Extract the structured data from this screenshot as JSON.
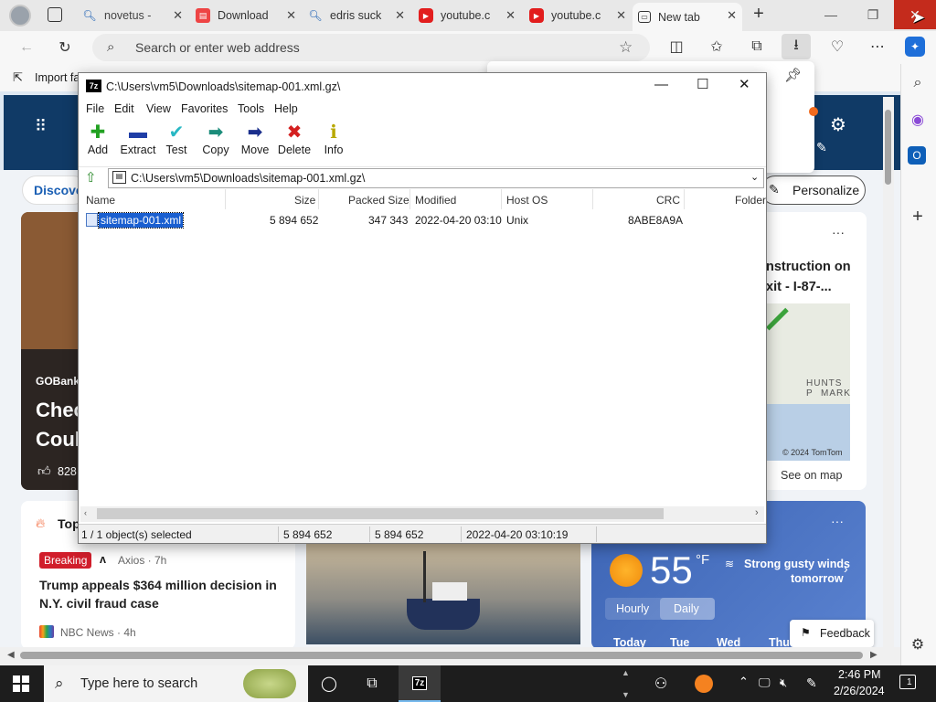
{
  "browser": {
    "tabs": [
      {
        "label": "novetus - ",
        "icon": "search-icon"
      },
      {
        "label": "Download",
        "icon": "download-page-icon"
      },
      {
        "label": "edris suck",
        "icon": "search-icon"
      },
      {
        "label": "youtube.c",
        "icon": "youtube-icon"
      },
      {
        "label": "youtube.c",
        "icon": "youtube-icon"
      },
      {
        "label": "New tab",
        "icon": "new-tab-icon"
      }
    ],
    "address_placeholder": "Search or enter web address",
    "favorites_import": "Import fa",
    "accent": "#0067c0"
  },
  "page": {
    "discover_label": "Discove",
    "personalize_label": "Personalize",
    "story_source": "GOBanki",
    "story_title_1": "Chec",
    "story_title_2": "Coul",
    "story_likes": "828",
    "traffic_title_1": "nstruction on",
    "traffic_title_2": "xit - I-87-...",
    "map_label_1": "HUNTS P",
    "map_label_2": "MARK",
    "map_copyright": "© 2024 TomTom",
    "see_on_map": "See on map",
    "top_label": "Top",
    "breaking_badge": "Breaking",
    "news_source_1": "Axios · 7h",
    "news_headline": "Trump appeals $364 million decision in N.Y. civil fraud case",
    "news_source_2": "NBC News · 4h",
    "weather_temp": "55",
    "weather_unit": "°F",
    "weather_alert_1": "Strong gusty winds",
    "weather_alert_2": "tomorrow",
    "weather_tabs": [
      "Hourly",
      "Daily"
    ],
    "weather_days": [
      "Today",
      "Tue",
      "Wed",
      "Thu"
    ],
    "feedback_label": "Feedback",
    "more_dots": "···"
  },
  "sevenzip": {
    "title": "C:\\Users\\vm5\\Downloads\\sitemap-001.xml.gz\\",
    "app_badge": "7z",
    "menu": [
      "File",
      "Edit",
      "View",
      "Favorites",
      "Tools",
      "Help"
    ],
    "toolbar": [
      {
        "label": "Add",
        "icon": "add-icon",
        "color": "#22a122"
      },
      {
        "label": "Extract",
        "icon": "extract-icon",
        "color": "#1f3ea6"
      },
      {
        "label": "Test",
        "icon": "test-icon",
        "color": "#29b8c4"
      },
      {
        "label": "Copy",
        "icon": "copy-icon",
        "color": "#1b8c7a"
      },
      {
        "label": "Move",
        "icon": "move-icon",
        "color": "#1b2f8c"
      },
      {
        "label": "Delete",
        "icon": "delete-icon",
        "color": "#d42020"
      },
      {
        "label": "Info",
        "icon": "info-icon",
        "color": "#b8a800"
      }
    ],
    "path": "C:\\Users\\vm5\\Downloads\\sitemap-001.xml.gz\\",
    "columns": [
      "Name",
      "Size",
      "Packed Size",
      "Modified",
      "Host OS",
      "CRC",
      "Folder"
    ],
    "rows": [
      {
        "name": "sitemap-001.xml",
        "size": "5 894 652",
        "packed": "347 343",
        "modified": "2022-04-20 03:10",
        "host": "Unix",
        "crc": "8ABE8A9A"
      }
    ],
    "status": {
      "selected": "1 / 1 object(s) selected",
      "size1": "5 894 652",
      "size2": "5 894 652",
      "date": "2022-04-20 03:10:19"
    }
  },
  "taskbar": {
    "search_placeholder": "Type here to search",
    "time": "2:46 PM",
    "date": "2/26/2024",
    "notification_count": "1",
    "active_app_badge": "7z"
  }
}
